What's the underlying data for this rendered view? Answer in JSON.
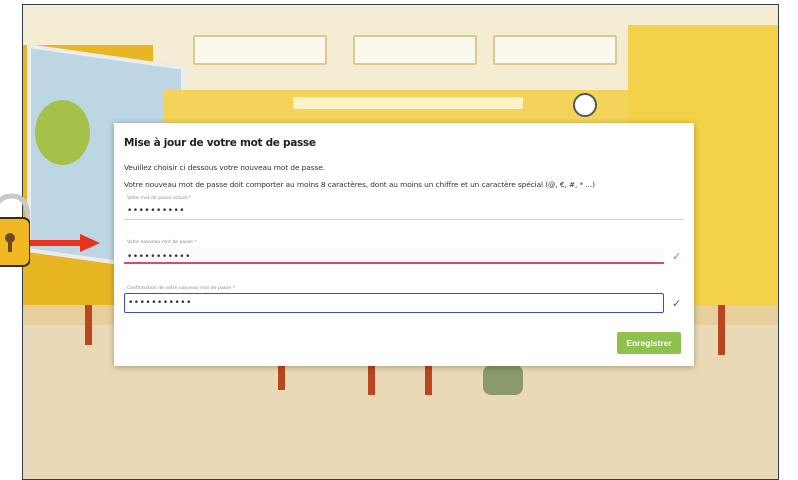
{
  "dialog": {
    "title": "Mise à jour de votre mot de passe",
    "description_line1": "Veuillez choisir ci dessous votre nouveau mot de passe.",
    "description_line2": "Votre nouveau mot de passe doit comporter au moins 8 caractères, dont au moins un chiffre et un caractère spécial (@, €, #, * ...)",
    "fields": [
      {
        "label": "Votre mot de passe actuel *",
        "value": "••••••••••",
        "state": "default"
      },
      {
        "label": "Votre nouveau mot de passe *",
        "value": "•••••••••••",
        "state": "error"
      },
      {
        "label": "Confirmation de votre nouveau mot de passe *",
        "value": "•••••••••••",
        "state": "focused"
      }
    ],
    "save_label": "Enregistrer"
  },
  "colors": {
    "primary_button": "#8fc050",
    "error_underline": "#e0466e",
    "focus_border": "#3b4fb0",
    "check_valid": "#6aaa3a",
    "check_focus": "#3b55b8",
    "arrow": "#e8321f",
    "lock": "#f2b824"
  },
  "icons": {
    "lock": "padlock-icon",
    "arrow": "red-right-arrow-icon",
    "new_password_check": "check-icon",
    "confirm_password_check": "check-icon"
  }
}
